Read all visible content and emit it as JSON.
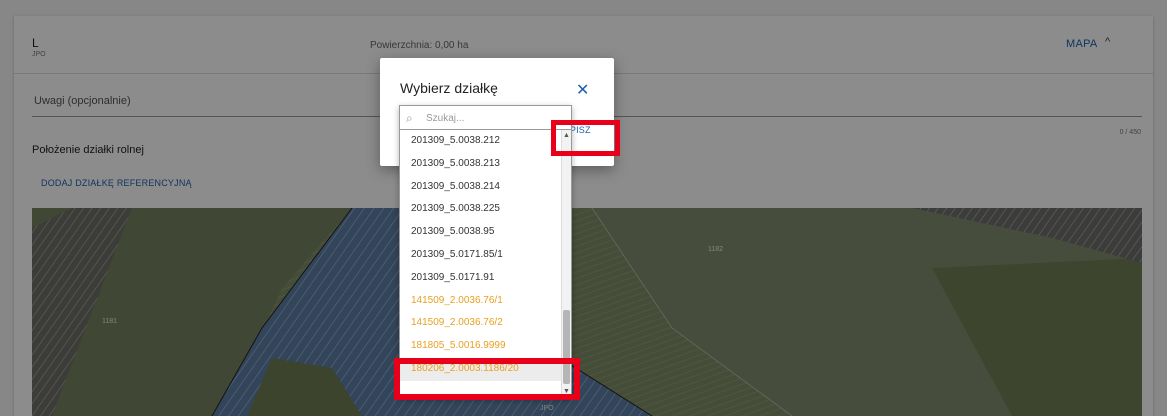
{
  "header": {
    "letter": "L",
    "sub": "JPO",
    "area": "Powierzchnia: 0,00 ha",
    "mapa_label": "MAPA",
    "chevron": "^"
  },
  "uwagi": {
    "label": "Uwagi (opcjonalnie)",
    "counter": "0 / 450"
  },
  "section": {
    "title": "Położenie działki rolnej",
    "add_link": "DODAJ DZIAŁKĘ REFERENCYJNĄ"
  },
  "map": {
    "labels": [
      "1181",
      "1182",
      "JPO"
    ]
  },
  "dialog": {
    "title": "Wybierz działkę",
    "close": "✕",
    "save": "ZAPISZ"
  },
  "search": {
    "placeholder": "Szukaj..."
  },
  "list": {
    "items": [
      {
        "label": "201309_5.0038.212",
        "status": "normal"
      },
      {
        "label": "201309_5.0038.213",
        "status": "normal"
      },
      {
        "label": "201309_5.0038.214",
        "status": "normal"
      },
      {
        "label": "201309_5.0038.225",
        "status": "normal"
      },
      {
        "label": "201309_5.0038.95",
        "status": "normal"
      },
      {
        "label": "201309_5.0171.85/1",
        "status": "normal"
      },
      {
        "label": "201309_5.0171.91",
        "status": "normal"
      },
      {
        "label": "141509_2.0036.76/1",
        "status": "warning"
      },
      {
        "label": "141509_2.0036.76/2",
        "status": "warning"
      },
      {
        "label": "181805_5.0016.9999",
        "status": "warning"
      },
      {
        "label": "180206_2.0003.1186/20",
        "status": "warning"
      }
    ]
  },
  "colors": {
    "accent": "#1e5fae",
    "warning": "#e8a020",
    "highlight_border": "#e8001a"
  }
}
